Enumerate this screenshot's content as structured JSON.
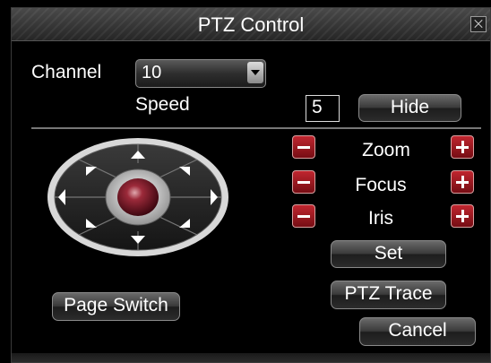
{
  "window": {
    "title": "PTZ Control"
  },
  "channel": {
    "label": "Channel",
    "value": "10"
  },
  "speed": {
    "label": "Speed",
    "value": "5"
  },
  "buttons": {
    "hide": "Hide",
    "set": "Set",
    "ptz_trace": "PTZ Trace",
    "cancel": "Cancel",
    "page_switch": "Page Switch"
  },
  "controls": [
    {
      "label": "Zoom"
    },
    {
      "label": "Focus"
    },
    {
      "label": "Iris"
    }
  ],
  "icons": {
    "close": "close-icon",
    "dropdown": "chevron-down-icon",
    "minus": "minus-icon",
    "plus": "plus-icon",
    "directions": [
      "up",
      "up-right",
      "right",
      "down-right",
      "down",
      "down-left",
      "left",
      "up-left"
    ],
    "center": "center-button"
  },
  "colors": {
    "background": "#000000",
    "accent_red": "#b01e27",
    "button_gray": "#3a3a3a",
    "text": "#ffffff"
  }
}
